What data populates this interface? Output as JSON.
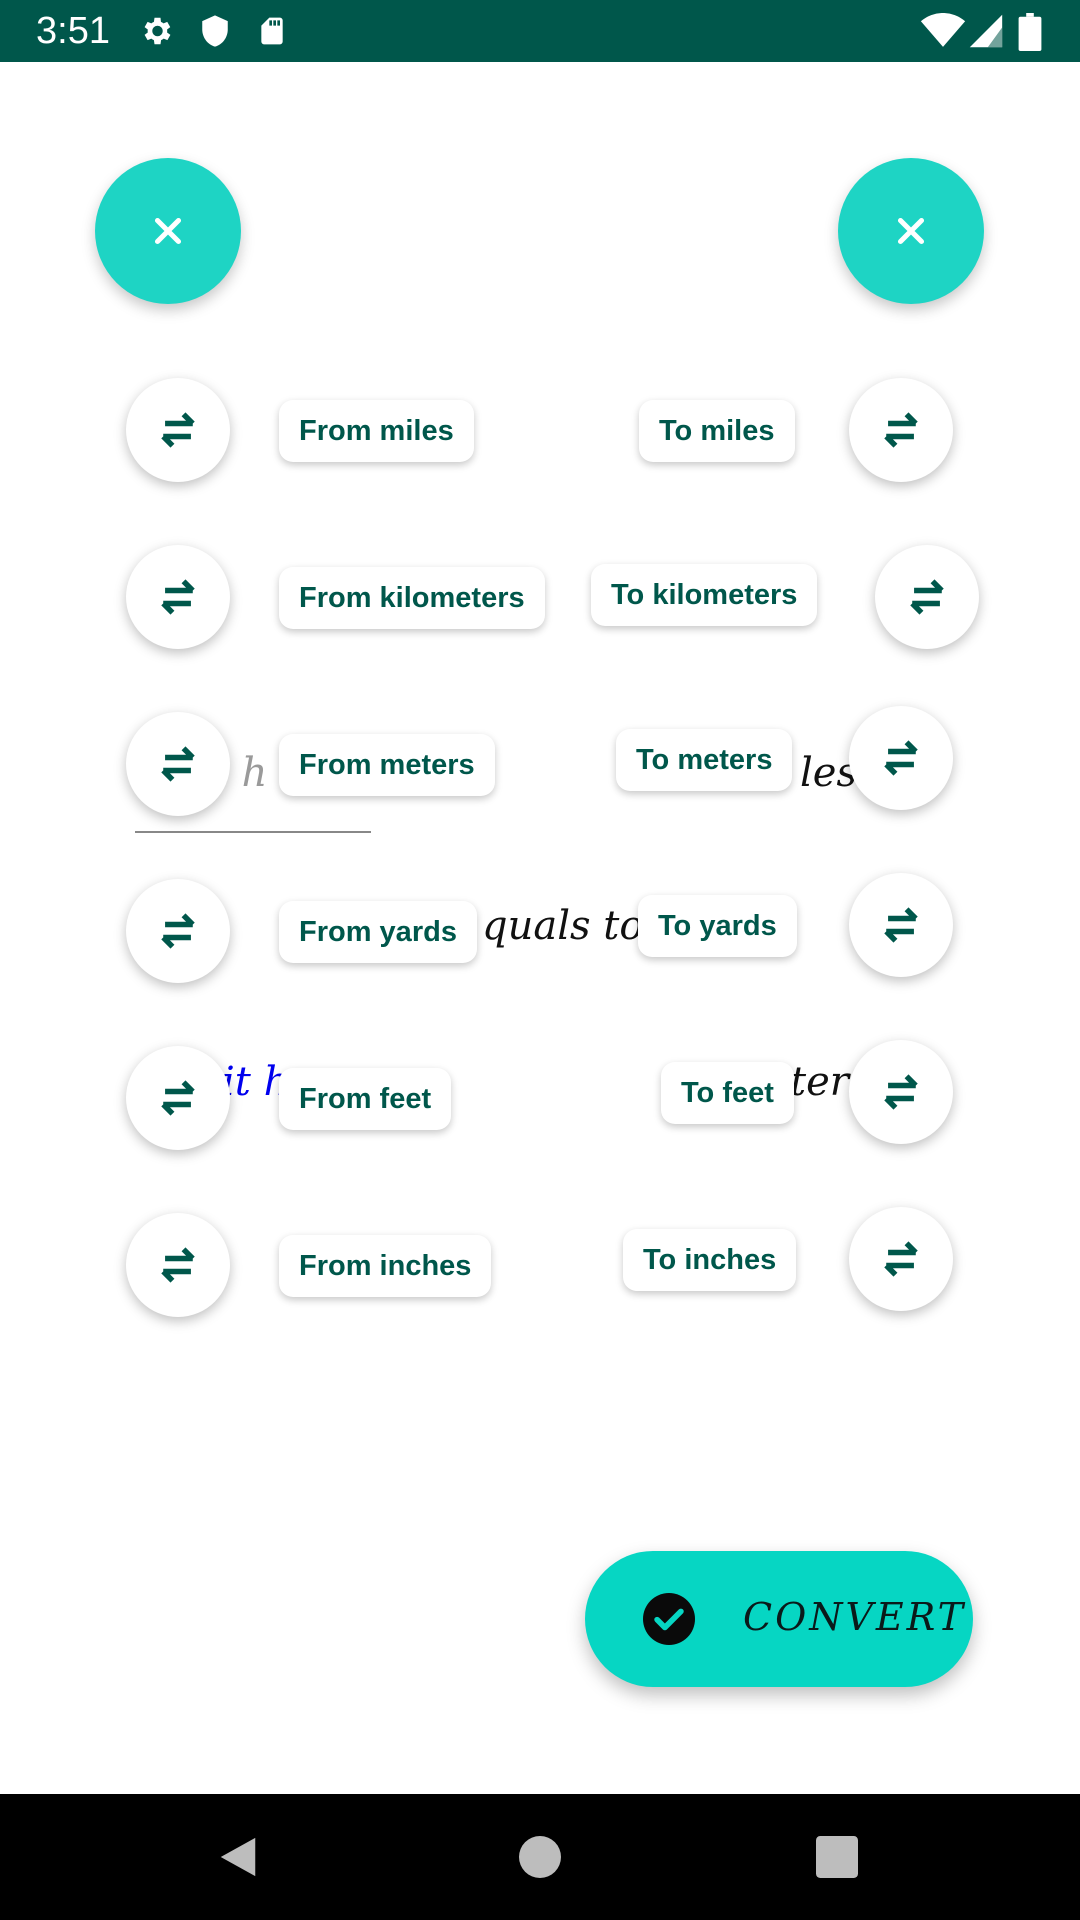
{
  "status_bar": {
    "time": "3:51",
    "left_icons": [
      "settings-icon",
      "shield-icon",
      "sd-card-icon"
    ],
    "right_icons": [
      "wifi-icon",
      "signal-icon",
      "battery-icon"
    ]
  },
  "top_actions": {
    "left_fab_icon": "close-icon",
    "right_fab_icon": "close-icon"
  },
  "from_units": [
    "From miles",
    "From kilometers",
    "From meters",
    "From yards",
    "From feet",
    "From inches"
  ],
  "to_units": [
    "To miles",
    "To kilometers",
    "To meters",
    "To yards",
    "To feet",
    "To inches"
  ],
  "swap_icon": "swap-horizontal-icon",
  "background_text": {
    "input_partial": "it h",
    "output_unit_partial": "les",
    "equals_label": "quals to",
    "result_partial": "it h",
    "result_unit_partial": "ters"
  },
  "convert_button": {
    "label": "CONVERT",
    "icon": "check-circle-icon"
  },
  "nav_bar": {
    "buttons": [
      "back-icon",
      "home-icon",
      "recents-icon"
    ]
  },
  "colors": {
    "status_bar": "#00574b",
    "accent": "#1ed4c4",
    "chip_text": "#00574b",
    "result_text": "#0000ee"
  }
}
